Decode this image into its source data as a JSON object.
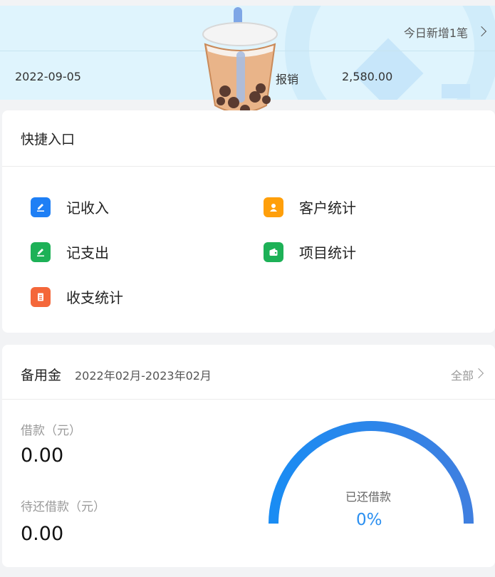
{
  "banner": {
    "today_new": "今日新增1笔",
    "record": {
      "date": "2022-09-05",
      "type": "报销",
      "amount": "2,580.00"
    }
  },
  "quick_entry": {
    "title": "快捷入口",
    "items": [
      {
        "label": "记收入",
        "icon": "edit-icon",
        "color": "#1e7ff5"
      },
      {
        "label": "客户统计",
        "icon": "person-icon",
        "color": "#ff9f0a"
      },
      {
        "label": "记支出",
        "icon": "edit-icon",
        "color": "#1db157"
      },
      {
        "label": "项目统计",
        "icon": "wallet-icon",
        "color": "#1db157"
      },
      {
        "label": "收支统计",
        "icon": "document-icon",
        "color": "#f4673a"
      }
    ]
  },
  "petty_cash": {
    "title": "备用金",
    "range": "2022年02月-2023年02月",
    "all_label": "全部",
    "borrow_label": "借款（元）",
    "borrow_value": "0.00",
    "pending_label": "待还借款（元）",
    "pending_value": "0.00",
    "gauge_title": "已还借款",
    "gauge_percent": "0%",
    "gauge_color": "#1e88f5"
  }
}
